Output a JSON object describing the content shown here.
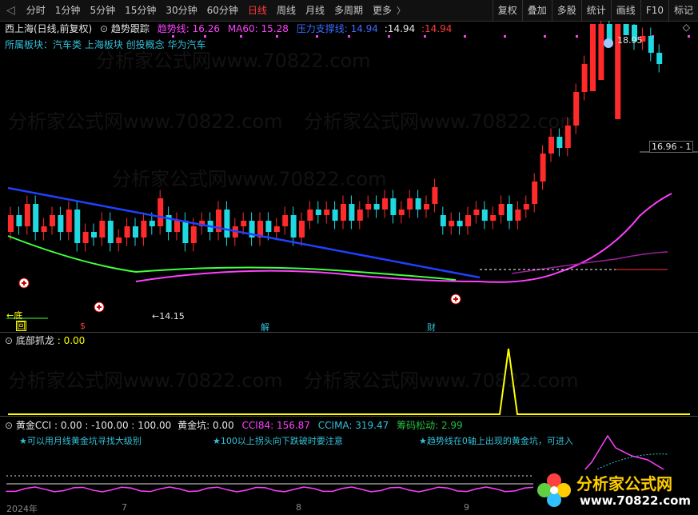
{
  "tabs": [
    "分时",
    "1分钟",
    "5分钟",
    "15分钟",
    "30分钟",
    "60分钟",
    "日线",
    "周线",
    "月线",
    "多周期",
    "更多"
  ],
  "active_tab": "日线",
  "tools": [
    "复权",
    "叠加",
    "多股",
    "统计",
    "画线",
    "F10",
    "标记"
  ],
  "main": {
    "stock": "西上海(日线,前复权)",
    "indicator": "趋势跟踪",
    "trend_label": "趋势线:",
    "trend_value": "16.26",
    "ma60_label": "MA60:",
    "ma60_value": "15.28",
    "pressure_label": "压力支撑线:",
    "pressure_value": "14.94",
    "val2": ":14.94",
    "val3": ":14.94",
    "sector": "所属板块：汽车类 上海板块 创投概念 华为汽车",
    "high_label": "18.95",
    "price_tag": "16.96 - 1",
    "low_label": "←14.15",
    "bottom_marker": "←底",
    "hui": "回",
    "s": "$",
    "jie": "解",
    "cai": "财"
  },
  "panel2": {
    "title": "底部抓龙",
    "value": ": 0.00"
  },
  "panel3": {
    "title": "黄金CCI",
    "values": ": 0.00 : -100.00 : 100.00",
    "pit_label": "黄金坑:",
    "pit_value": "0.00",
    "cci84": "CCI84: 156.87",
    "ccima": "CCIMA: 319.47",
    "chip": "筹码松动: 2.99",
    "note1": "★可以用月线黄金坑寻找大级别",
    "note2": "★100以上拐头向下跌破时要注意",
    "note3": "★趋势线在0轴上出现的黄金坑，可进入"
  },
  "dates": [
    "2024年",
    "7",
    "8",
    "9"
  ],
  "watermark": "分析家公式网www.70822.com",
  "logo": {
    "name": "分析家公式网",
    "url": "www.70822.com"
  },
  "colors": {
    "up": "#ff2a2a",
    "down": "#20d8e0",
    "trend": "#ff40ff",
    "ma60": "#2040ff",
    "green": "#40ff40",
    "yellow": "#ffff00"
  }
}
